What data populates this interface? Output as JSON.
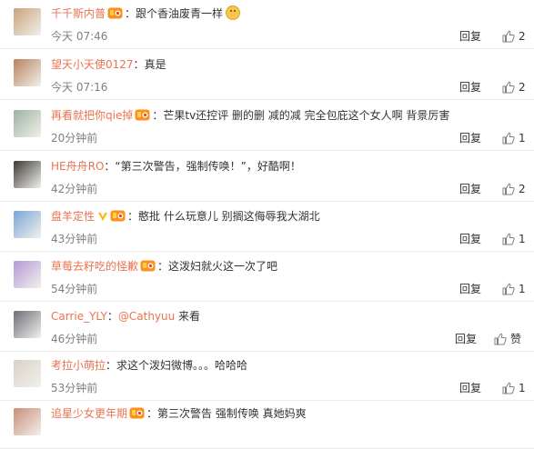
{
  "comments": [
    {
      "user": "千千斯内普",
      "text": "跟个香油废青一样",
      "time": "今天 07:46",
      "reply": "回复",
      "likes": "2",
      "has_badge": true,
      "has_vip": false,
      "has_emoji": true,
      "avatar_color": "#c9a37a"
    },
    {
      "user": "望天小天使0127",
      "text": "真是",
      "time": "今天 07:16",
      "reply": "回复",
      "likes": "2",
      "has_badge": false,
      "has_vip": false,
      "has_emoji": false,
      "avatar_color": "#b8845e"
    },
    {
      "user": "再看就把你qie掉",
      "text": "芒果tv还控评 删的删 减的减 完全包庇这个女人啊 背景厉害",
      "time": "20分钟前",
      "reply": "回复",
      "likes": "1",
      "has_badge": true,
      "has_vip": false,
      "has_emoji": false,
      "avatar_color": "#9bb3a0"
    },
    {
      "user": "HE舟舟RO",
      "text": "“第三次警告，强制传唤！”，好酷啊！",
      "time": "42分钟前",
      "reply": "回复",
      "likes": "2",
      "has_badge": false,
      "has_vip": false,
      "has_emoji": false,
      "avatar_color": "#3c3a35"
    },
    {
      "user": "盘羊定性",
      "text": "憨批 什么玩意儿 别搁这侮辱我大湖北",
      "time": "43分钟前",
      "reply": "回复",
      "likes": "1",
      "has_badge": true,
      "has_vip": true,
      "has_emoji": false,
      "avatar_color": "#7aa6d8"
    },
    {
      "user": "草莓去籽吃的怪歉",
      "text": "这泼妇就火这一次了吧",
      "time": "54分钟前",
      "reply": "回复",
      "likes": "1",
      "has_badge": true,
      "has_vip": false,
      "has_emoji": false,
      "avatar_color": "#b49ad6"
    },
    {
      "user": "Carrie_YLY",
      "mention": "@Cathyuu",
      "text": " 来看",
      "time": "46分钟前",
      "reply": "回复",
      "likes": "赞",
      "has_badge": false,
      "has_vip": false,
      "has_emoji": false,
      "avatar_color": "#6d6f78"
    },
    {
      "user": "考拉小萌拉",
      "text": "求这个泼妇微博。。。哈哈哈",
      "time": "53分钟前",
      "reply": "回复",
      "likes": "1",
      "has_badge": false,
      "has_vip": false,
      "has_emoji": false,
      "avatar_color": "#d7d2c8"
    },
    {
      "user": "追星少女更年期",
      "text": "第三次警告 强制传唤 真她妈爽",
      "time": "",
      "reply": "",
      "likes": "",
      "has_badge": true,
      "has_vip": false,
      "has_emoji": false,
      "avatar_color": "#c98f7a"
    }
  ],
  "icons": {
    "like": "thumbs-up-icon",
    "badge": "member-badge-icon",
    "vip": "vip-v-icon",
    "emoji": "smile-emoji-icon"
  },
  "colors": {
    "username": "#eb7350",
    "text": "#333333",
    "time": "#808080",
    "divider": "#eaeaea"
  }
}
